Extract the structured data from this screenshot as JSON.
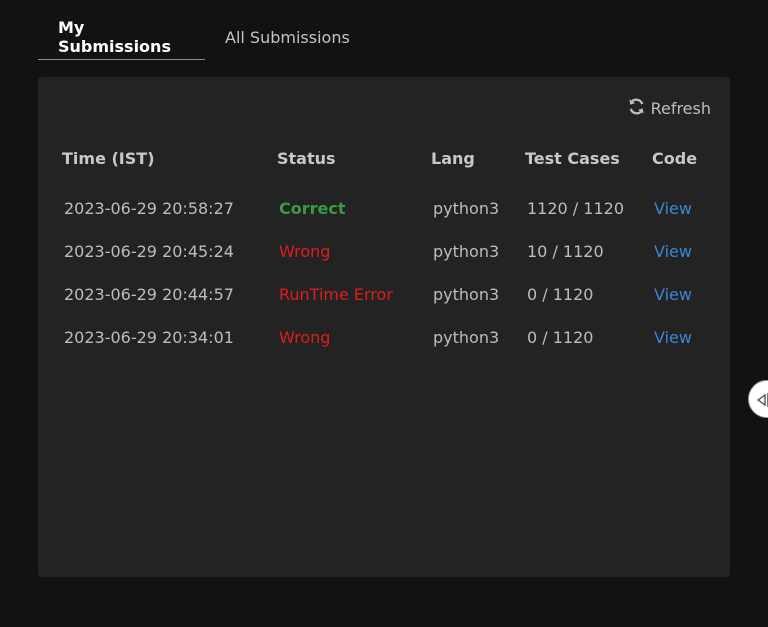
{
  "tabs": [
    {
      "label": "My Submissions",
      "active": true
    },
    {
      "label": "All Submissions",
      "active": false
    }
  ],
  "refresh": {
    "label": "Refresh",
    "icon": "refresh-icon"
  },
  "table": {
    "headers": [
      "Time (IST)",
      "Status",
      "Lang",
      "Test Cases",
      "Code"
    ],
    "rows": [
      {
        "time": "2023-06-29 20:58:27",
        "status": "Correct",
        "status_kind": "correct",
        "lang": "python3",
        "tests": "1120 / 1120",
        "code": "View"
      },
      {
        "time": "2023-06-29 20:45:24",
        "status": "Wrong",
        "status_kind": "wrong",
        "lang": "python3",
        "tests": "10 / 1120",
        "code": "View"
      },
      {
        "time": "2023-06-29 20:44:57",
        "status": "RunTime Error",
        "status_kind": "error",
        "lang": "python3",
        "tests": "0 / 1120",
        "code": "View"
      },
      {
        "time": "2023-06-29 20:34:01",
        "status": "Wrong",
        "status_kind": "wrong",
        "lang": "python3",
        "tests": "0 / 1120",
        "code": "View"
      }
    ]
  },
  "colors": {
    "correct": "#3b9a43",
    "wrong": "#e01c1c",
    "link": "#3d86d6",
    "background": "#121212",
    "panel": "#232323"
  },
  "side_toggle": {
    "icon": "collapse-arrow-icon"
  }
}
